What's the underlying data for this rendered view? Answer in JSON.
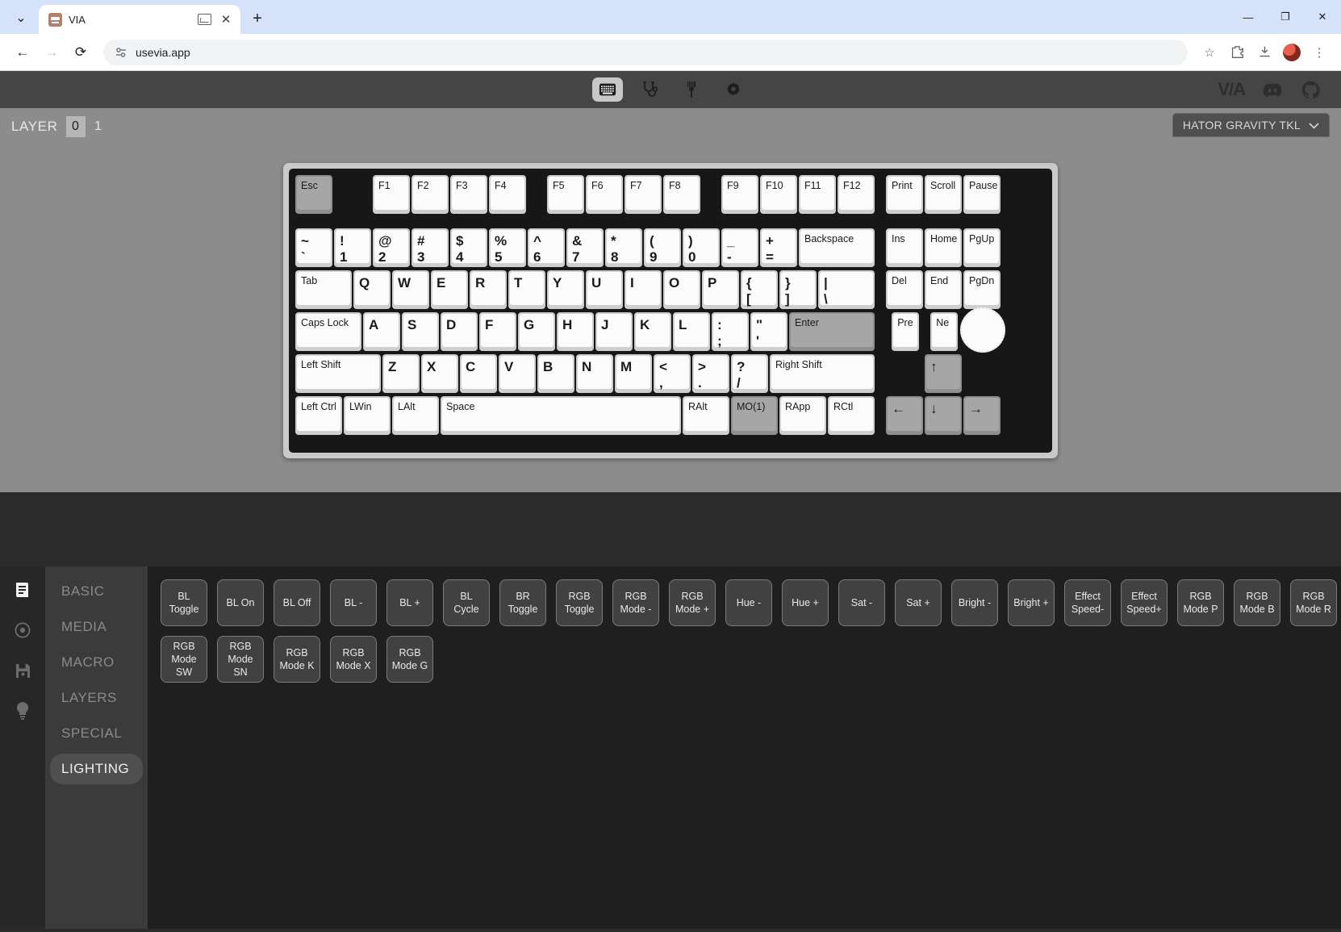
{
  "browser": {
    "tab": {
      "title": "VIA",
      "favicon_name": "via-favicon",
      "mini_icon_name": "tab-media-icon",
      "close_label": "✕"
    },
    "new_tab_label": "+",
    "tabstrip_menu_label": "⌄",
    "window_controls": {
      "minimize": "—",
      "maximize": "❐",
      "close": "✕"
    },
    "nav": {
      "back": "←",
      "forward": "→",
      "reload": "⟳"
    },
    "omnibox": {
      "url": "usevia.app",
      "site_icon_name": "site-settings-icon"
    },
    "actions": {
      "bookmark": "☆",
      "extensions": "extensions-icon",
      "downloads": "downloads-icon",
      "profile": "profile-avatar",
      "menu": "⋮"
    }
  },
  "app": {
    "header": {
      "tabs": [
        {
          "name": "keymap",
          "icon": "keyboard-icon",
          "active": true
        },
        {
          "name": "debug",
          "icon": "stethoscope-icon",
          "active": false
        },
        {
          "name": "design",
          "icon": "paintbrush-icon",
          "active": false
        },
        {
          "name": "settings",
          "icon": "gear-icon",
          "active": false
        }
      ],
      "logo": "V/A",
      "links": [
        {
          "name": "discord",
          "icon": "discord-icon"
        },
        {
          "name": "github",
          "icon": "github-icon"
        }
      ]
    },
    "layer_bar": {
      "label": "LAYER",
      "layers": [
        "0",
        "1"
      ],
      "active_layer": "0"
    },
    "keyboard_select": {
      "value": "HATOR GRAVITY TKL",
      "chevron": "⌄"
    },
    "keyboard": {
      "rows": [
        [
          {
            "label": "Esc",
            "x": 0,
            "w": 1,
            "dark": true
          },
          {
            "label": "F1",
            "x": 2,
            "w": 1
          },
          {
            "label": "F2",
            "x": 3,
            "w": 1
          },
          {
            "label": "F3",
            "x": 4,
            "w": 1
          },
          {
            "label": "F4",
            "x": 5,
            "w": 1
          },
          {
            "label": "F5",
            "x": 6.5,
            "w": 1
          },
          {
            "label": "F6",
            "x": 7.5,
            "w": 1
          },
          {
            "label": "F7",
            "x": 8.5,
            "w": 1
          },
          {
            "label": "F8",
            "x": 9.5,
            "w": 1
          },
          {
            "label": "F9",
            "x": 11,
            "w": 1
          },
          {
            "label": "F10",
            "x": 12,
            "w": 1
          },
          {
            "label": "F11",
            "x": 13,
            "w": 1
          },
          {
            "label": "F12",
            "x": 14,
            "w": 1
          },
          {
            "label": "Print",
            "x": 15.25,
            "w": 1
          },
          {
            "label": "Scroll",
            "x": 16.25,
            "w": 1
          },
          {
            "label": "Pause",
            "x": 17.25,
            "w": 1
          }
        ],
        [
          {
            "label": "~",
            "label2": "`",
            "x": 0,
            "w": 1,
            "big": true
          },
          {
            "label": "!",
            "label2": "1",
            "x": 1,
            "w": 1,
            "big": true
          },
          {
            "label": "@",
            "label2": "2",
            "x": 2,
            "w": 1,
            "big": true
          },
          {
            "label": "#",
            "label2": "3",
            "x": 3,
            "w": 1,
            "big": true
          },
          {
            "label": "$",
            "label2": "4",
            "x": 4,
            "w": 1,
            "big": true
          },
          {
            "label": "%",
            "label2": "5",
            "x": 5,
            "w": 1,
            "big": true
          },
          {
            "label": "^",
            "label2": "6",
            "x": 6,
            "w": 1,
            "big": true
          },
          {
            "label": "&",
            "label2": "7",
            "x": 7,
            "w": 1,
            "big": true
          },
          {
            "label": "*",
            "label2": "8",
            "x": 8,
            "w": 1,
            "big": true
          },
          {
            "label": "(",
            "label2": "9",
            "x": 9,
            "w": 1,
            "big": true
          },
          {
            "label": ")",
            "label2": "0",
            "x": 10,
            "w": 1,
            "big": true
          },
          {
            "label": "_",
            "label2": "-",
            "x": 11,
            "w": 1,
            "big": true
          },
          {
            "label": "+",
            "label2": "=",
            "x": 12,
            "w": 1,
            "big": true
          },
          {
            "label": "Backspace",
            "x": 13,
            "w": 2
          },
          {
            "label": "Ins",
            "x": 15.25,
            "w": 1
          },
          {
            "label": "Home",
            "x": 16.25,
            "w": 1
          },
          {
            "label": "PgUp",
            "x": 17.25,
            "w": 1
          }
        ],
        [
          {
            "label": "Tab",
            "x": 0,
            "w": 1.5
          },
          {
            "label": "Q",
            "x": 1.5,
            "w": 1,
            "big": true
          },
          {
            "label": "W",
            "x": 2.5,
            "w": 1,
            "big": true
          },
          {
            "label": "E",
            "x": 3.5,
            "w": 1,
            "big": true
          },
          {
            "label": "R",
            "x": 4.5,
            "w": 1,
            "big": true
          },
          {
            "label": "T",
            "x": 5.5,
            "w": 1,
            "big": true
          },
          {
            "label": "Y",
            "x": 6.5,
            "w": 1,
            "big": true
          },
          {
            "label": "U",
            "x": 7.5,
            "w": 1,
            "big": true
          },
          {
            "label": "I",
            "x": 8.5,
            "w": 1,
            "big": true
          },
          {
            "label": "O",
            "x": 9.5,
            "w": 1,
            "big": true
          },
          {
            "label": "P",
            "x": 10.5,
            "w": 1,
            "big": true
          },
          {
            "label": "{",
            "label2": "[",
            "x": 11.5,
            "w": 1,
            "big": true
          },
          {
            "label": "}",
            "label2": "]",
            "x": 12.5,
            "w": 1,
            "big": true
          },
          {
            "label": "|",
            "label2": "\\",
            "x": 13.5,
            "w": 1.5,
            "big": true
          },
          {
            "label": "Del",
            "x": 15.25,
            "w": 1
          },
          {
            "label": "End",
            "x": 16.25,
            "w": 1
          },
          {
            "label": "PgDn",
            "x": 17.25,
            "w": 1
          }
        ],
        [
          {
            "label": "Caps Lock",
            "x": 0,
            "w": 1.75
          },
          {
            "label": "A",
            "x": 1.75,
            "w": 1,
            "big": true
          },
          {
            "label": "S",
            "x": 2.75,
            "w": 1,
            "big": true
          },
          {
            "label": "D",
            "x": 3.75,
            "w": 1,
            "big": true
          },
          {
            "label": "F",
            "x": 4.75,
            "w": 1,
            "big": true
          },
          {
            "label": "G",
            "x": 5.75,
            "w": 1,
            "big": true
          },
          {
            "label": "H",
            "x": 6.75,
            "w": 1,
            "big": true
          },
          {
            "label": "J",
            "x": 7.75,
            "w": 1,
            "big": true
          },
          {
            "label": "K",
            "x": 8.75,
            "w": 1,
            "big": true
          },
          {
            "label": "L",
            "x": 9.75,
            "w": 1,
            "big": true
          },
          {
            "label": ":",
            "label2": ";",
            "x": 10.75,
            "w": 1,
            "big": true
          },
          {
            "label": "\"",
            "label2": "'",
            "x": 11.75,
            "w": 1,
            "big": true
          },
          {
            "label": "Enter",
            "x": 12.75,
            "w": 2.25,
            "dark": true
          },
          {
            "label": "Pre",
            "x": 15.4,
            "w": 0.75
          },
          {
            "label": "Ne",
            "x": 16.4,
            "w": 0.75
          }
        ],
        [
          {
            "label": "Left Shift",
            "x": 0,
            "w": 2.25
          },
          {
            "label": "Z",
            "x": 2.25,
            "w": 1,
            "big": true
          },
          {
            "label": "X",
            "x": 3.25,
            "w": 1,
            "big": true
          },
          {
            "label": "C",
            "x": 4.25,
            "w": 1,
            "big": true
          },
          {
            "label": "V",
            "x": 5.25,
            "w": 1,
            "big": true
          },
          {
            "label": "B",
            "x": 6.25,
            "w": 1,
            "big": true
          },
          {
            "label": "N",
            "x": 7.25,
            "w": 1,
            "big": true
          },
          {
            "label": "M",
            "x": 8.25,
            "w": 1,
            "big": true
          },
          {
            "label": "<",
            "label2": ",",
            "x": 9.25,
            "w": 1,
            "big": true
          },
          {
            "label": ">",
            "label2": ".",
            "x": 10.25,
            "w": 1,
            "big": true
          },
          {
            "label": "?",
            "label2": "/",
            "x": 11.25,
            "w": 1,
            "big": true
          },
          {
            "label": "Right Shift",
            "x": 12.25,
            "w": 2.75
          },
          {
            "label": "↑",
            "x": 16.25,
            "w": 1,
            "dark": true,
            "big": true
          }
        ],
        [
          {
            "label": "Left Ctrl",
            "x": 0,
            "w": 1.25
          },
          {
            "label": "LWin",
            "x": 1.25,
            "w": 1.25
          },
          {
            "label": "LAlt",
            "x": 2.5,
            "w": 1.25
          },
          {
            "label": "Space",
            "x": 3.75,
            "w": 6.25
          },
          {
            "label": "RAlt",
            "x": 10,
            "w": 1.25
          },
          {
            "label": "MO(1)",
            "x": 11.25,
            "w": 1.25,
            "dark": true
          },
          {
            "label": "RApp",
            "x": 12.5,
            "w": 1.25
          },
          {
            "label": "RCtl",
            "x": 13.75,
            "w": 1.25
          },
          {
            "label": "←",
            "x": 15.25,
            "w": 1,
            "dark": true,
            "big": true
          },
          {
            "label": "↓",
            "x": 16.25,
            "w": 1,
            "dark": true,
            "big": true
          },
          {
            "label": "→",
            "x": 17.25,
            "w": 1,
            "dark": true,
            "big": true
          }
        ]
      ],
      "encoder": {
        "name": "rotary-encoder-knob"
      }
    },
    "bottom_panel": {
      "rail_icons": [
        {
          "name": "keymap-icon",
          "glyph": "book",
          "active": true
        },
        {
          "name": "macro-record-icon",
          "glyph": "record",
          "active": false
        },
        {
          "name": "save-icon",
          "glyph": "save",
          "active": false
        },
        {
          "name": "lighting-icon",
          "glyph": "bulb",
          "active": false
        }
      ],
      "categories": [
        {
          "label": "BASIC",
          "active": false
        },
        {
          "label": "MEDIA",
          "active": false
        },
        {
          "label": "MACRO",
          "active": false
        },
        {
          "label": "LAYERS",
          "active": false
        },
        {
          "label": "SPECIAL",
          "active": false
        },
        {
          "label": "LIGHTING",
          "active": true
        }
      ],
      "keycodes": [
        "BL\nToggle",
        "BL On",
        "BL Off",
        "BL -",
        "BL +",
        "BL\nCycle",
        "BR\nToggle",
        "RGB\nToggle",
        "RGB\nMode -",
        "RGB\nMode +",
        "Hue -",
        "Hue +",
        "Sat -",
        "Sat +",
        "Bright -",
        "Bright +",
        "Effect\nSpeed-",
        "Effect\nSpeed+",
        "RGB\nMode P",
        "RGB\nMode B",
        "RGB\nMode R",
        "RGB\nMode\nSW",
        "RGB\nMode\nSN",
        "RGB\nMode K",
        "RGB\nMode X",
        "RGB\nMode G"
      ]
    }
  }
}
